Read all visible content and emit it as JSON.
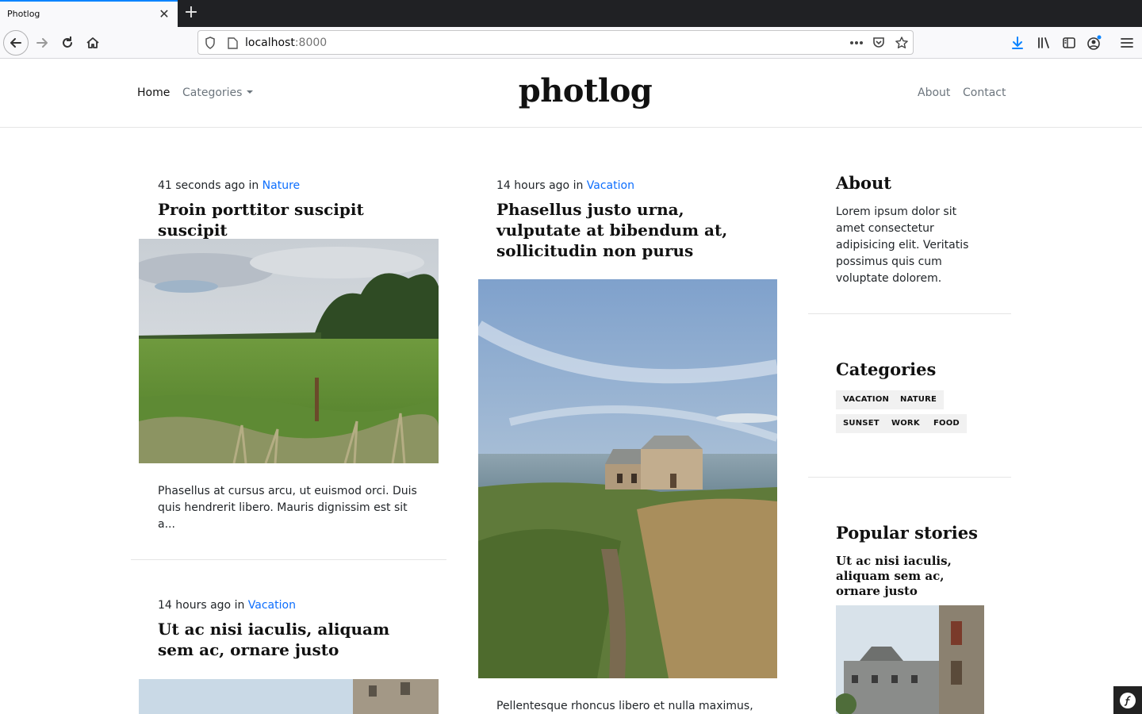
{
  "browser": {
    "tab_title": "Photlog",
    "url_host": "localhost",
    "url_port": ":8000",
    "icons": [
      "back-icon",
      "forward-icon",
      "reload-icon",
      "home-icon",
      "shield-icon",
      "page-icon",
      "more-icon",
      "pocket-icon",
      "star-icon",
      "download-icon",
      "library-icon",
      "sidebar-icon",
      "account-icon",
      "menu-icon"
    ]
  },
  "header": {
    "brand": "photlog",
    "nav_left": [
      {
        "label": "Home"
      },
      {
        "label": "Categories"
      }
    ],
    "nav_right": [
      {
        "label": "About"
      },
      {
        "label": "Contact"
      }
    ]
  },
  "posts": [
    {
      "time": "41 seconds ago",
      "in": "in",
      "category": "Nature",
      "title": "Proin porttitor suscipit suscipit",
      "excerpt": "Phasellus at cursus arcu, ut euismod orci. Duis quis hendrerit libero. Mauris dignissim est sit a..."
    },
    {
      "time": "14 hours ago",
      "in": "in",
      "category": "Vacation",
      "title": "Phasellus justo urna, vulputate at bibendum at, sollicitudin non purus",
      "excerpt": "Pellentesque rhoncus libero et nulla maximus,"
    },
    {
      "time": "14 hours ago",
      "in": "in",
      "category": "Vacation",
      "title": "Ut ac nisi iaculis, aliquam sem ac, ornare justo"
    }
  ],
  "sidebar": {
    "about_heading": "About",
    "about_text": "Lorem ipsum dolor sit amet consectetur adipisicing elit. Veritatis possimus quis cum voluptate dolorem.",
    "categories_heading": "Categories",
    "tags": [
      "VACATION",
      "NATURE",
      "SUNSET",
      "WORK",
      "FOOD"
    ],
    "popular_heading": "Popular stories",
    "popular_title": "Ut ac nisi iaculis, aliquam sem ac, ornare justo"
  },
  "colors": {
    "link": "#0d6efd",
    "tab_accent": "#0a84ff"
  }
}
